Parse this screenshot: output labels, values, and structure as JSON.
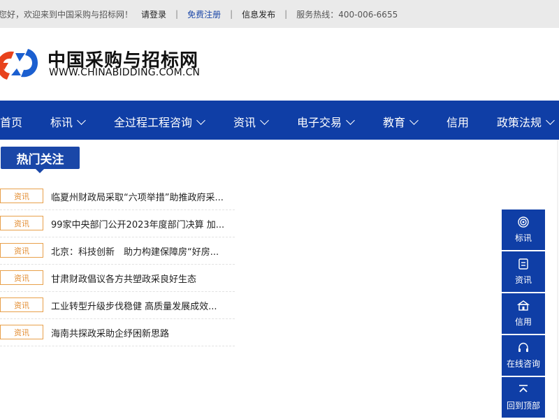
{
  "topbar": {
    "greeting": "您好，欢迎来到中国采购与招标网！",
    "login": "请登录",
    "register": "免费注册",
    "publish": "信息发布",
    "hotline": "服务热线：400-006-6655",
    "separator": "|"
  },
  "logo": {
    "cn": "中国采购与招标网",
    "en": "WWW.CHINABIDDING.COM.CN",
    "colors": {
      "red": "#e8421c",
      "blue": "#1b5fd0"
    }
  },
  "nav": {
    "items": [
      {
        "label": "首页",
        "has_dropdown": false
      },
      {
        "label": "标讯",
        "has_dropdown": true
      },
      {
        "label": "全过程工程咨询",
        "has_dropdown": true
      },
      {
        "label": "资讯",
        "has_dropdown": true
      },
      {
        "label": "电子交易",
        "has_dropdown": true
      },
      {
        "label": "教育",
        "has_dropdown": true
      },
      {
        "label": "信用",
        "has_dropdown": false
      },
      {
        "label": "政策法规",
        "has_dropdown": true
      }
    ],
    "background": "#0f3ea6"
  },
  "hot": {
    "title": "热门关注",
    "news": [
      {
        "tag": "资讯",
        "title": "临夏州财政局采取“六项举措”助推政府采..."
      },
      {
        "tag": "资讯",
        "title": "99家中央部门公开2023年度部门决算 加..."
      },
      {
        "tag": "资讯",
        "title": "北京：科技创新　助力构建保障房“好房..."
      },
      {
        "tag": "资讯",
        "title": "甘肃财政倡议各方共塑政采良好生态"
      },
      {
        "tag": "资讯",
        "title": "工业转型升级步伐稳健 高质量发展成效..."
      },
      {
        "tag": "资讯",
        "title": "海南共探政采助企纾困新思路"
      }
    ]
  },
  "float_panel": {
    "buttons": [
      {
        "label": "标讯",
        "icon": "target-icon"
      },
      {
        "label": "资讯",
        "icon": "document-icon"
      },
      {
        "label": "信用",
        "icon": "bank-icon"
      },
      {
        "label": "在线咨询",
        "icon": "headset-icon"
      },
      {
        "label": "回到顶部",
        "icon": "to-top-icon"
      }
    ]
  }
}
